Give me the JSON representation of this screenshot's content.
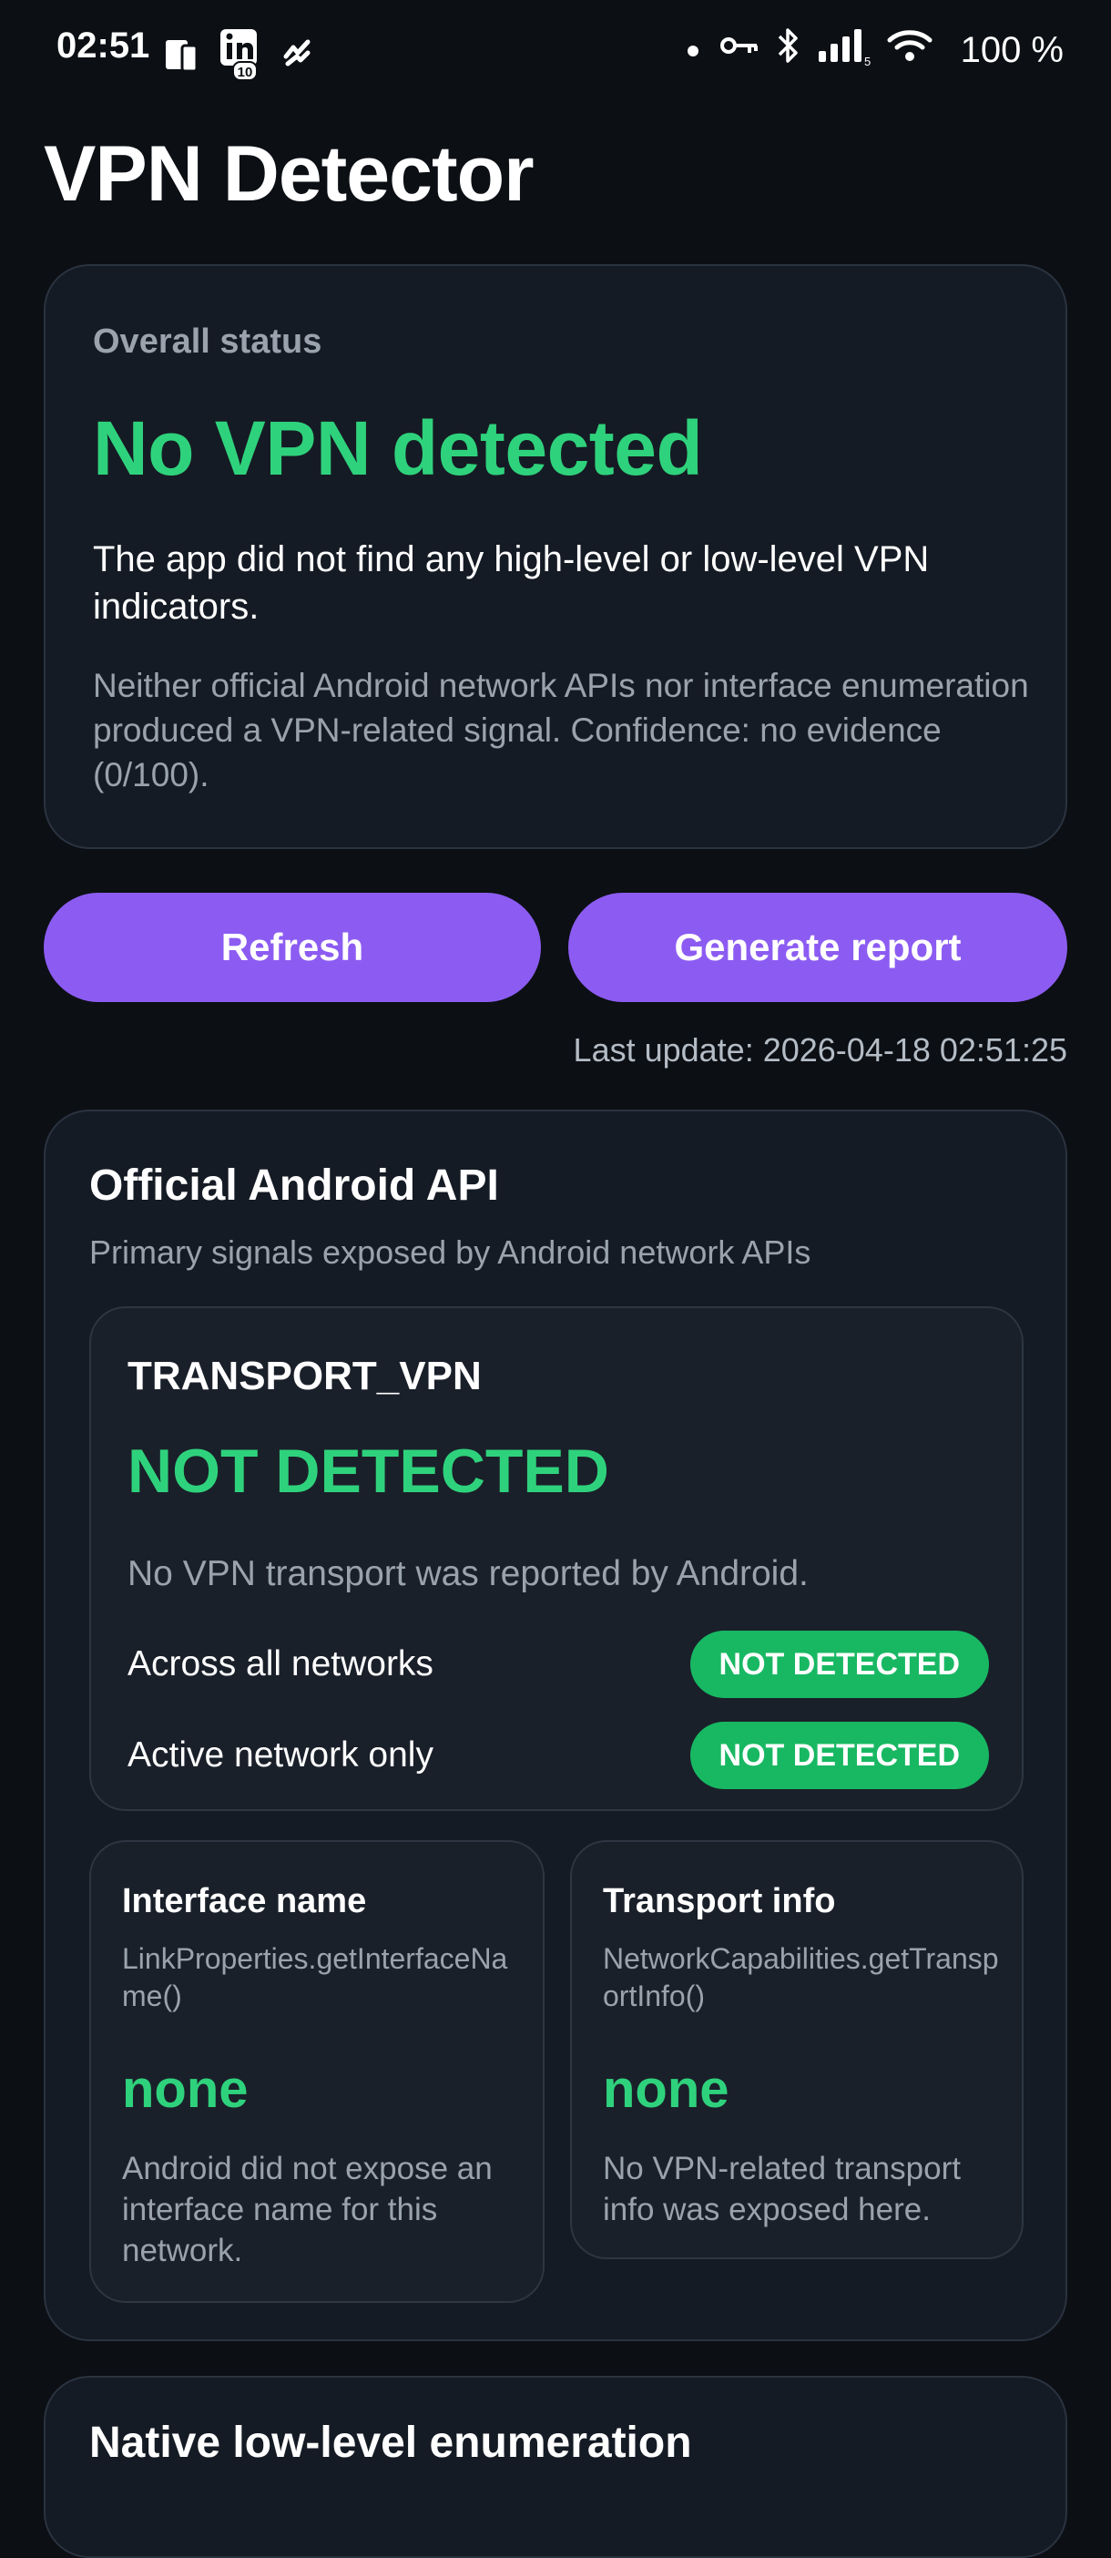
{
  "status_bar": {
    "time": "02:51",
    "battery": "100 %",
    "left_icons": [
      "screen-cast-icon",
      "linkedin-notification-icon",
      "app-notification-icon"
    ],
    "right_icons": [
      "dot-icon",
      "vpn-key-icon",
      "bluetooth-icon",
      "cellular-signal-icon",
      "wifi-icon"
    ]
  },
  "app": {
    "title": "VPN Detector"
  },
  "overall": {
    "label": "Overall status",
    "headline": "No VPN detected",
    "description": "The app did not find any high-level or low-level VPN indicators.",
    "detail": "Neither official Android network APIs nor interface enumeration produced a VPN-related signal. Confidence: no evidence (0/100)."
  },
  "actions": {
    "refresh_label": "Refresh",
    "report_label": "Generate report"
  },
  "last_update": "Last update: 2026-04-18 02:51:25",
  "official_api": {
    "title": "Official Android API",
    "subtitle": "Primary signals exposed by Android network APIs",
    "transport_vpn": {
      "title": "TRANSPORT_VPN",
      "status": "NOT DETECTED",
      "description": "No VPN transport was reported by Android.",
      "rows": [
        {
          "label": "Across all networks",
          "badge": "NOT DETECTED"
        },
        {
          "label": "Active network only",
          "badge": "NOT DETECTED"
        }
      ]
    },
    "interface_name": {
      "title": "Interface name",
      "api": "LinkProperties.getInterfaceName()",
      "value": "none",
      "description": "Android did not expose an interface name for this network."
    },
    "transport_info": {
      "title": "Transport info",
      "api": "NetworkCapabilities.getTransportInfo()",
      "value": "none",
      "description": "No VPN-related transport info was exposed here."
    }
  },
  "native": {
    "title": "Native low-level enumeration"
  },
  "colors": {
    "background": "#0c0f14",
    "card": "#151b24",
    "accent_green": "#2fd27c",
    "badge_green": "#18b863",
    "button_purple": "#8c5cf2",
    "muted_text": "#9aa3ad"
  }
}
